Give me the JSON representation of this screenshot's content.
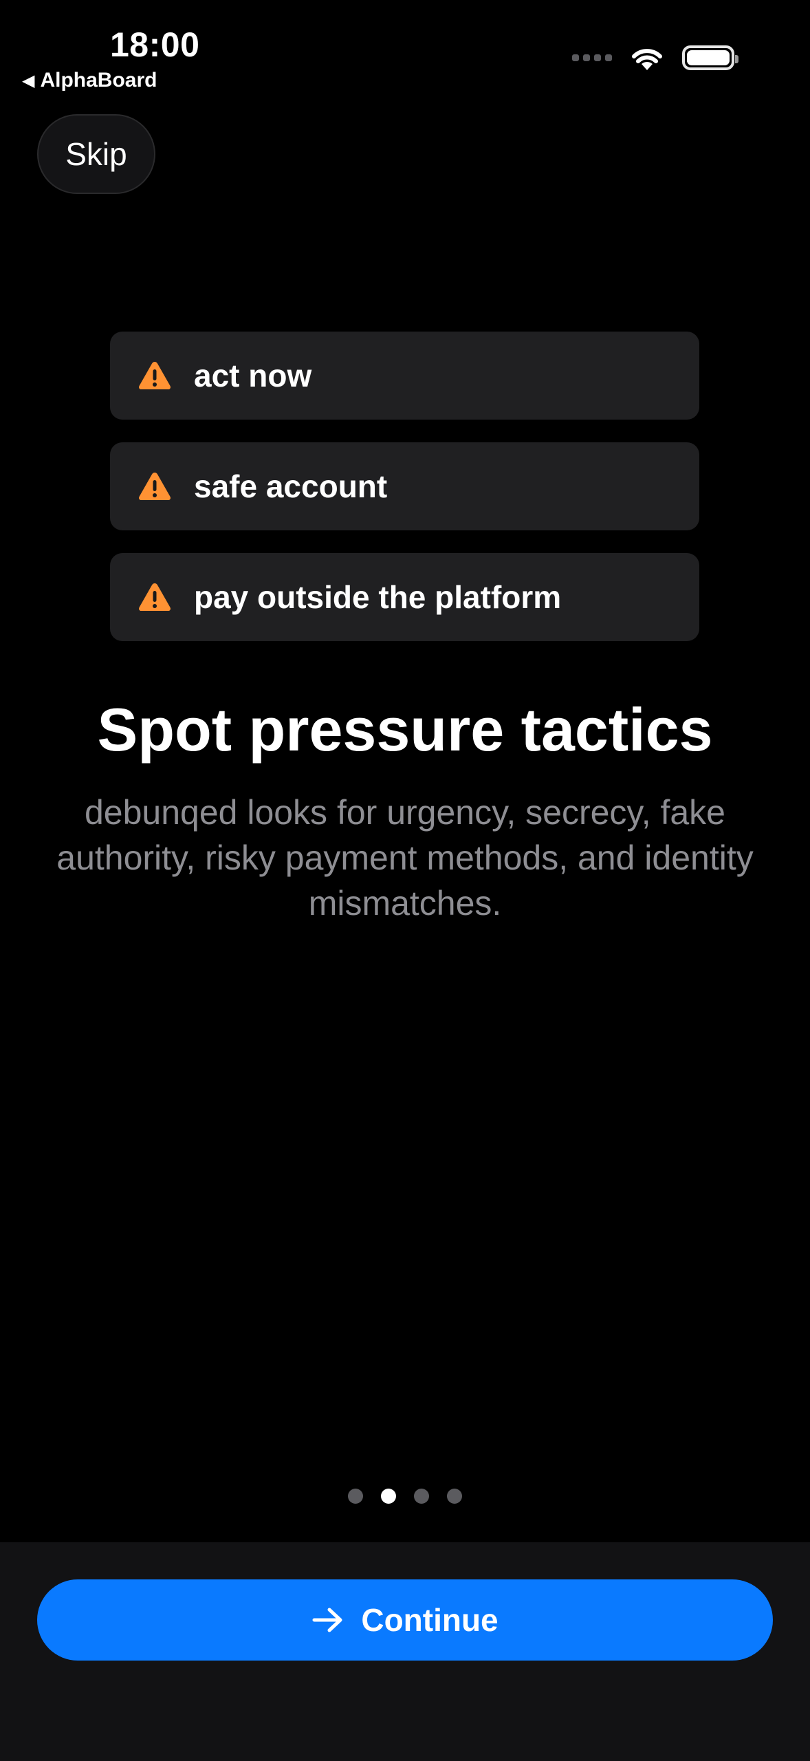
{
  "status_bar": {
    "time": "18:00",
    "back_app": "AlphaBoard"
  },
  "skip_label": "Skip",
  "warnings": [
    {
      "label": "act now",
      "icon": "warning-triangle-icon"
    },
    {
      "label": "safe account",
      "icon": "warning-triangle-icon"
    },
    {
      "label": "pay outside the platform",
      "icon": "warning-triangle-icon"
    }
  ],
  "title": "Spot pressure tactics",
  "subtitle": "debunqed looks for urgency, secrecy, fake authority, risky payment methods, and identity mismatches.",
  "pagination": {
    "total": 4,
    "current": 2
  },
  "continue_label": "Continue",
  "colors": {
    "accent": "#0a7aff",
    "warning": "#ff9233",
    "background": "#000000",
    "card": "#202022",
    "subtitle": "#8e8e93"
  }
}
